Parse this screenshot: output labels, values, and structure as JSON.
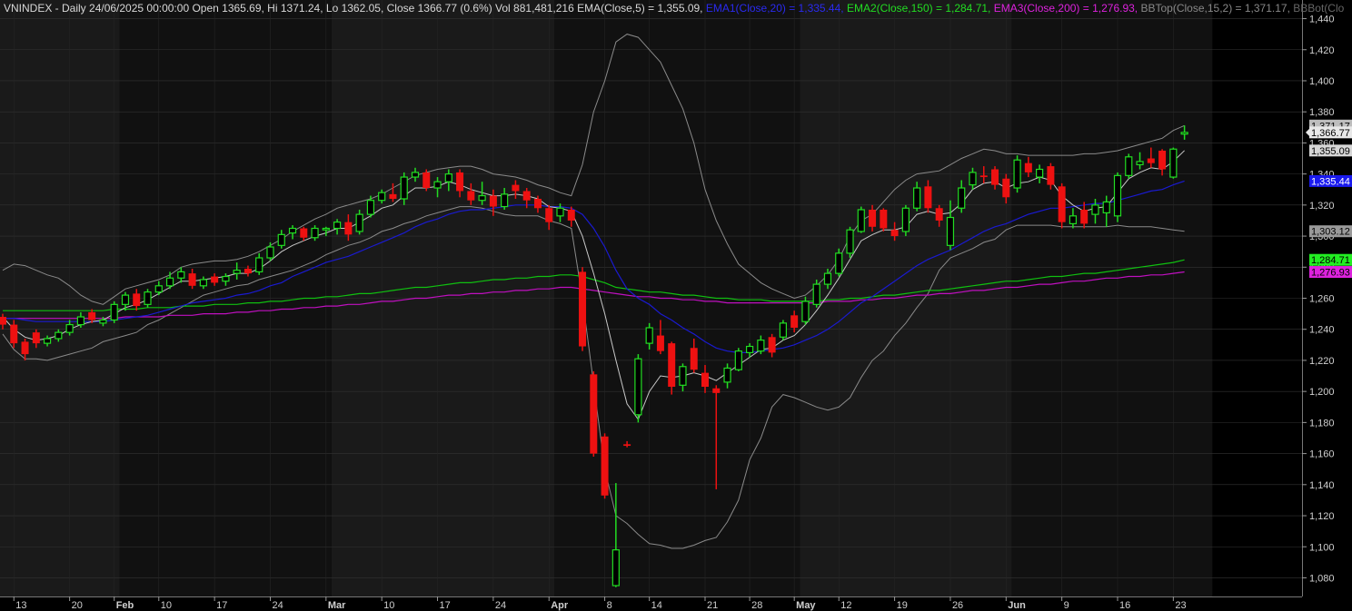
{
  "header": {
    "main": "VNINDEX - Daily 24/06/2025 00:00:00 Open 1365.69, Hi 1371.24, Lo 1362.05, Close 1366.77 (0.6%) Vol 881,481,216 EMA(Close,5) = 1,355.09,",
    "ema1": " EMA1(Close,20) = 1,335.44,",
    "ema2": " EMA2(Close,150) = 1,284.71,",
    "ema3": " EMA3(Close,200) = 1,276.93,",
    "bbtop": " BBTop(Close,15,2) = 1,371.17,",
    "bbbot": " BBBot(Clo"
  },
  "colors": {
    "background": "#000000",
    "band_even": "#1a1a1a",
    "band_odd": "#111111",
    "grid": "#333333",
    "axis_text": "#d0d0d0",
    "header_text": "#d8d8d8",
    "up": "#22dd22",
    "down": "#ee1111",
    "ema5": "#c8c8c8",
    "ema20": "#1a1ad0",
    "ema150": "#10c010",
    "ema200": "#c010c0",
    "bb": "#8a8a8a"
  },
  "chart_data": {
    "type": "candlestick",
    "symbol": "VNINDEX",
    "y_ticks": [
      1080,
      1100,
      1120,
      1140,
      1160,
      1180,
      1200,
      1220,
      1240,
      1260,
      1280,
      1300,
      1320,
      1340,
      1360,
      1380,
      1400,
      1420,
      1440
    ],
    "ylim": [
      1068,
      1452
    ],
    "x_labels": [
      "13",
      "20",
      "Feb",
      "10",
      "17",
      "24",
      "Mar",
      "10",
      "17",
      "24",
      "Apr",
      "8",
      "14",
      "21",
      "28",
      "May",
      "12",
      "19",
      "26",
      "Jun",
      "9",
      "16",
      "23"
    ],
    "x_label_bar_index": [
      1,
      6,
      10,
      14,
      19,
      24,
      29,
      34,
      39,
      44,
      49,
      54,
      58,
      63,
      67,
      71,
      75,
      80,
      85,
      90,
      95,
      100,
      105
    ],
    "bold_labels": [
      "Feb",
      "Mar",
      "Apr",
      "May",
      "Jun"
    ],
    "candles": [
      [
        1248,
        1250,
        1240,
        1243
      ],
      [
        1243,
        1246,
        1228,
        1231
      ],
      [
        1232,
        1234,
        1220,
        1224
      ],
      [
        1238,
        1240,
        1228,
        1231
      ],
      [
        1231,
        1236,
        1229,
        1234
      ],
      [
        1234,
        1240,
        1232,
        1238
      ],
      [
        1238,
        1246,
        1236,
        1243
      ],
      [
        1243,
        1251,
        1241,
        1248
      ],
      [
        1251,
        1253,
        1244,
        1246
      ],
      [
        1244,
        1248,
        1242,
        1246
      ],
      [
        1246,
        1258,
        1244,
        1256
      ],
      [
        1256,
        1264,
        1252,
        1262
      ],
      [
        1263,
        1266,
        1252,
        1255
      ],
      [
        1256,
        1266,
        1254,
        1264
      ],
      [
        1264,
        1271,
        1262,
        1268
      ],
      [
        1268,
        1277,
        1266,
        1273
      ],
      [
        1273,
        1280,
        1270,
        1277
      ],
      [
        1276,
        1279,
        1266,
        1268
      ],
      [
        1268,
        1274,
        1266,
        1272
      ],
      [
        1274,
        1276,
        1268,
        1270
      ],
      [
        1271,
        1276,
        1268,
        1274
      ],
      [
        1276,
        1283,
        1272,
        1278
      ],
      [
        1279,
        1281,
        1274,
        1276
      ],
      [
        1277,
        1289,
        1275,
        1286
      ],
      [
        1286,
        1296,
        1284,
        1293
      ],
      [
        1294,
        1304,
        1292,
        1301
      ],
      [
        1302,
        1307,
        1298,
        1305
      ],
      [
        1305,
        1306,
        1297,
        1299
      ],
      [
        1299,
        1307,
        1297,
        1305
      ],
      [
        1304,
        1306,
        1300,
        1305
      ],
      [
        1305,
        1311,
        1301,
        1309
      ],
      [
        1309,
        1314,
        1297,
        1301
      ],
      [
        1303,
        1317,
        1301,
        1314
      ],
      [
        1314,
        1326,
        1312,
        1323
      ],
      [
        1323,
        1330,
        1321,
        1328
      ],
      [
        1327,
        1334,
        1322,
        1324
      ],
      [
        1324,
        1341,
        1320,
        1338
      ],
      [
        1338,
        1344,
        1335,
        1341
      ],
      [
        1341,
        1343,
        1329,
        1331
      ],
      [
        1331,
        1338,
        1325,
        1335
      ],
      [
        1335,
        1343,
        1329,
        1340
      ],
      [
        1341,
        1343,
        1325,
        1329
      ],
      [
        1329,
        1334,
        1320,
        1323
      ],
      [
        1323,
        1335,
        1320,
        1326
      ],
      [
        1326,
        1330,
        1313,
        1319
      ],
      [
        1319,
        1331,
        1317,
        1327
      ],
      [
        1333,
        1336,
        1324,
        1329
      ],
      [
        1329,
        1331,
        1318,
        1323
      ],
      [
        1324,
        1326,
        1315,
        1318
      ],
      [
        1318,
        1320,
        1304,
        1309
      ],
      [
        1313,
        1321,
        1309,
        1318
      ],
      [
        1317,
        1319,
        1306,
        1310
      ],
      [
        1277,
        1280,
        1226,
        1229
      ],
      [
        1211,
        1213,
        1158,
        1160
      ],
      [
        1171,
        1173,
        1131,
        1133
      ],
      [
        1075,
        1141,
        1074,
        1098
      ],
      [
        1166,
        1168,
        1164,
        1165
      ],
      [
        1185,
        1224,
        1180,
        1221
      ],
      [
        1231,
        1244,
        1227,
        1241
      ],
      [
        1236,
        1246,
        1224,
        1226
      ],
      [
        1231,
        1232,
        1198,
        1203
      ],
      [
        1204,
        1218,
        1200,
        1216
      ],
      [
        1228,
        1234,
        1212,
        1214
      ],
      [
        1212,
        1217,
        1199,
        1203
      ],
      [
        1202,
        1204,
        1137,
        1199
      ],
      [
        1206,
        1218,
        1202,
        1215
      ],
      [
        1214,
        1228,
        1213,
        1226
      ],
      [
        1225,
        1231,
        1222,
        1229
      ],
      [
        1226,
        1236,
        1224,
        1233
      ],
      [
        1235,
        1237,
        1222,
        1225
      ],
      [
        1235,
        1246,
        1233,
        1244
      ],
      [
        1249,
        1252,
        1238,
        1241
      ],
      [
        1245,
        1261,
        1243,
        1258
      ],
      [
        1256,
        1272,
        1254,
        1269
      ],
      [
        1269,
        1279,
        1266,
        1276
      ],
      [
        1276,
        1292,
        1274,
        1289
      ],
      [
        1289,
        1306,
        1286,
        1304
      ],
      [
        1303,
        1319,
        1302,
        1317
      ],
      [
        1317,
        1320,
        1303,
        1306
      ],
      [
        1317,
        1318,
        1303,
        1305
      ],
      [
        1304,
        1309,
        1297,
        1300
      ],
      [
        1303,
        1320,
        1300,
        1318
      ],
      [
        1318,
        1335,
        1316,
        1331
      ],
      [
        1332,
        1336,
        1315,
        1318
      ],
      [
        1318,
        1320,
        1306,
        1310
      ],
      [
        1294,
        1323,
        1291,
        1312
      ],
      [
        1318,
        1336,
        1315,
        1331
      ],
      [
        1333,
        1344,
        1330,
        1341
      ],
      [
        1339,
        1345,
        1334,
        1338
      ],
      [
        1343,
        1345,
        1330,
        1333
      ],
      [
        1337,
        1340,
        1321,
        1325
      ],
      [
        1331,
        1352,
        1328,
        1349
      ],
      [
        1347,
        1351,
        1338,
        1341
      ],
      [
        1338,
        1346,
        1334,
        1343
      ],
      [
        1345,
        1347,
        1330,
        1333
      ],
      [
        1332,
        1334,
        1305,
        1309
      ],
      [
        1308,
        1318,
        1305,
        1313
      ],
      [
        1317,
        1322,
        1305,
        1308
      ],
      [
        1314,
        1324,
        1308,
        1320
      ],
      [
        1315,
        1326,
        1306,
        1322
      ],
      [
        1313,
        1341,
        1309,
        1339
      ],
      [
        1339,
        1353,
        1337,
        1351
      ],
      [
        1346,
        1354,
        1343,
        1348
      ],
      [
        1350,
        1357,
        1344,
        1347
      ],
      [
        1355,
        1356,
        1339,
        1343
      ],
      [
        1338,
        1357,
        1337,
        1356
      ],
      [
        1365.69,
        1371.24,
        1362.05,
        1366.77
      ]
    ],
    "ema5": [
      1248,
      1240,
      1235,
      1233,
      1234,
      1236,
      1240,
      1243,
      1245,
      1246,
      1250,
      1254,
      1256,
      1259,
      1263,
      1267,
      1271,
      1271,
      1272,
      1273,
      1274,
      1276,
      1276,
      1279,
      1284,
      1290,
      1294,
      1297,
      1300,
      1302,
      1305,
      1305,
      1309,
      1313,
      1318,
      1320,
      1326,
      1331,
      1331,
      1332,
      1335,
      1333,
      1330,
      1328,
      1326,
      1326,
      1327,
      1326,
      1324,
      1319,
      1318,
      1316,
      1300,
      1276,
      1250,
      1220,
      1192,
      1182,
      1200,
      1210,
      1209,
      1210,
      1212,
      1210,
      1207,
      1212,
      1217,
      1222,
      1227,
      1228,
      1233,
      1236,
      1243,
      1252,
      1262,
      1273,
      1285,
      1297,
      1301,
      1304,
      1304,
      1306,
      1314,
      1316,
      1314,
      1315,
      1321,
      1330,
      1334,
      1335,
      1331,
      1334,
      1335,
      1338,
      1336,
      1326,
      1320,
      1316,
      1318,
      1319,
      1328,
      1337,
      1341,
      1344,
      1343,
      1348,
      1355.09
    ],
    "ema20": [
      1247,
      1247,
      1246,
      1245,
      1245,
      1245,
      1245,
      1245,
      1245,
      1245,
      1246,
      1247,
      1248,
      1249,
      1251,
      1253,
      1255,
      1257,
      1258,
      1259,
      1260,
      1262,
      1263,
      1265,
      1268,
      1270,
      1274,
      1277,
      1280,
      1283,
      1285,
      1287,
      1290,
      1293,
      1296,
      1299,
      1302,
      1306,
      1309,
      1311,
      1314,
      1316,
      1317,
      1317,
      1318,
      1319,
      1320,
      1320,
      1320,
      1319,
      1319,
      1318,
      1314,
      1305,
      1293,
      1278,
      1266,
      1260,
      1256,
      1250,
      1246,
      1241,
      1237,
      1232,
      1228,
      1226,
      1225,
      1225,
      1226,
      1227,
      1228,
      1230,
      1233,
      1236,
      1240,
      1245,
      1251,
      1257,
      1261,
      1266,
      1271,
      1276,
      1281,
      1285,
      1288,
      1291,
      1295,
      1299,
      1303,
      1306,
      1308,
      1311,
      1314,
      1316,
      1318,
      1318,
      1319,
      1320,
      1321,
      1321,
      1323,
      1325,
      1327,
      1329,
      1330,
      1333,
      1335.44
    ],
    "ema150": [
      1252,
      1252,
      1252,
      1252,
      1252,
      1252,
      1252,
      1252,
      1252,
      1252,
      1253,
      1253,
      1253,
      1254,
      1254,
      1254,
      1255,
      1255,
      1255,
      1256,
      1256,
      1256,
      1257,
      1257,
      1258,
      1258,
      1259,
      1260,
      1260,
      1261,
      1261,
      1262,
      1263,
      1263,
      1264,
      1265,
      1266,
      1267,
      1267,
      1268,
      1269,
      1270,
      1270,
      1271,
      1272,
      1272,
      1273,
      1273,
      1274,
      1274,
      1275,
      1275,
      1274,
      1272,
      1270,
      1267,
      1266,
      1265,
      1264,
      1264,
      1263,
      1262,
      1262,
      1261,
      1260,
      1260,
      1259,
      1259,
      1259,
      1258,
      1258,
      1258,
      1258,
      1258,
      1259,
      1259,
      1260,
      1260,
      1261,
      1262,
      1262,
      1263,
      1264,
      1265,
      1265,
      1266,
      1267,
      1268,
      1269,
      1270,
      1271,
      1271,
      1272,
      1273,
      1274,
      1274,
      1275,
      1276,
      1276,
      1277,
      1278,
      1279,
      1280,
      1281,
      1282,
      1283,
      1284.71
    ],
    "ema200": [
      1247,
      1247,
      1247,
      1247,
      1247,
      1247,
      1247,
      1247,
      1247,
      1247,
      1247,
      1248,
      1248,
      1248,
      1248,
      1249,
      1249,
      1249,
      1250,
      1250,
      1250,
      1251,
      1251,
      1252,
      1252,
      1253,
      1253,
      1254,
      1254,
      1255,
      1255,
      1256,
      1256,
      1257,
      1258,
      1258,
      1259,
      1260,
      1260,
      1261,
      1262,
      1262,
      1263,
      1263,
      1264,
      1264,
      1265,
      1265,
      1266,
      1266,
      1267,
      1267,
      1266,
      1265,
      1264,
      1263,
      1262,
      1261,
      1261,
      1260,
      1260,
      1259,
      1259,
      1258,
      1258,
      1257,
      1257,
      1257,
      1257,
      1257,
      1257,
      1257,
      1257,
      1257,
      1258,
      1258,
      1258,
      1259,
      1259,
      1260,
      1260,
      1261,
      1262,
      1262,
      1263,
      1263,
      1264,
      1265,
      1265,
      1266,
      1267,
      1267,
      1268,
      1269,
      1269,
      1270,
      1271,
      1271,
      1272,
      1273,
      1273,
      1274,
      1274,
      1275,
      1275,
      1276,
      1276.93
    ],
    "bb_upper": [
      1278,
      1282,
      1281,
      1278,
      1275,
      1273,
      1268,
      1262,
      1258,
      1256,
      1261,
      1266,
      1268,
      1270,
      1272,
      1275,
      1280,
      1282,
      1283,
      1284,
      1284,
      1285,
      1287,
      1290,
      1294,
      1298,
      1303,
      1307,
      1311,
      1314,
      1318,
      1320,
      1322,
      1324,
      1327,
      1331,
      1335,
      1339,
      1341,
      1343,
      1344,
      1345,
      1345,
      1343,
      1340,
      1339,
      1338,
      1336,
      1333,
      1331,
      1328,
      1326,
      1346,
      1380,
      1400,
      1425,
      1430,
      1428,
      1420,
      1412,
      1397,
      1382,
      1360,
      1330,
      1310,
      1295,
      1282,
      1276,
      1270,
      1266,
      1263,
      1260,
      1262,
      1268,
      1275,
      1285,
      1300,
      1310,
      1314,
      1322,
      1330,
      1336,
      1340,
      1341,
      1342,
      1346,
      1350,
      1353,
      1356,
      1355,
      1353,
      1353,
      1352,
      1352,
      1352,
      1352,
      1352,
      1353,
      1353,
      1354,
      1355,
      1357,
      1359,
      1361,
      1363,
      1368,
      1371.17
    ],
    "bb_lower": [
      1237,
      1227,
      1221,
      1221,
      1220,
      1222,
      1224,
      1226,
      1228,
      1232,
      1234,
      1236,
      1238,
      1243,
      1246,
      1250,
      1254,
      1258,
      1262,
      1264,
      1266,
      1268,
      1269,
      1272,
      1274,
      1276,
      1278,
      1281,
      1284,
      1288,
      1291,
      1294,
      1296,
      1299,
      1303,
      1305,
      1308,
      1310,
      1313,
      1315,
      1317,
      1319,
      1319,
      1318,
      1316,
      1314,
      1313,
      1313,
      1313,
      1310,
      1308,
      1305,
      1260,
      1205,
      1150,
      1120,
      1115,
      1108,
      1102,
      1101,
      1099,
      1099,
      1101,
      1104,
      1106,
      1116,
      1130,
      1156,
      1170,
      1190,
      1198,
      1196,
      1193,
      1190,
      1188,
      1190,
      1196,
      1209,
      1220,
      1226,
      1236,
      1244,
      1254,
      1263,
      1278,
      1286,
      1289,
      1292,
      1296,
      1298,
      1304,
      1307,
      1307,
      1307,
      1307,
      1306,
      1306,
      1306,
      1306,
      1306,
      1307,
      1306,
      1306,
      1306,
      1305,
      1304,
      1303.12
    ]
  },
  "price_tags": [
    {
      "text": "1,371.17",
      "value": 1371.17,
      "bg": "#bdbdbd",
      "fg": "#000000"
    },
    {
      "text": "1,366.77",
      "value": 1366.77,
      "bg": "#e8e8e8",
      "fg": "#000000",
      "arrow": true
    },
    {
      "text": "1,355.09",
      "value": 1355.09,
      "bg": "#d6d6d6",
      "fg": "#000000"
    },
    {
      "text": "1,335.44",
      "value": 1335.44,
      "bg": "#1a1aee",
      "fg": "#ffffff"
    },
    {
      "text": "1,303.12",
      "value": 1303.12,
      "bg": "#9a9a9a",
      "fg": "#000000"
    },
    {
      "text": "1,284.71",
      "value": 1284.71,
      "bg": "#22ee22",
      "fg": "#000000"
    },
    {
      "text": "1,276.93",
      "value": 1276.93,
      "bg": "#dd22dd",
      "fg": "#000000"
    }
  ]
}
